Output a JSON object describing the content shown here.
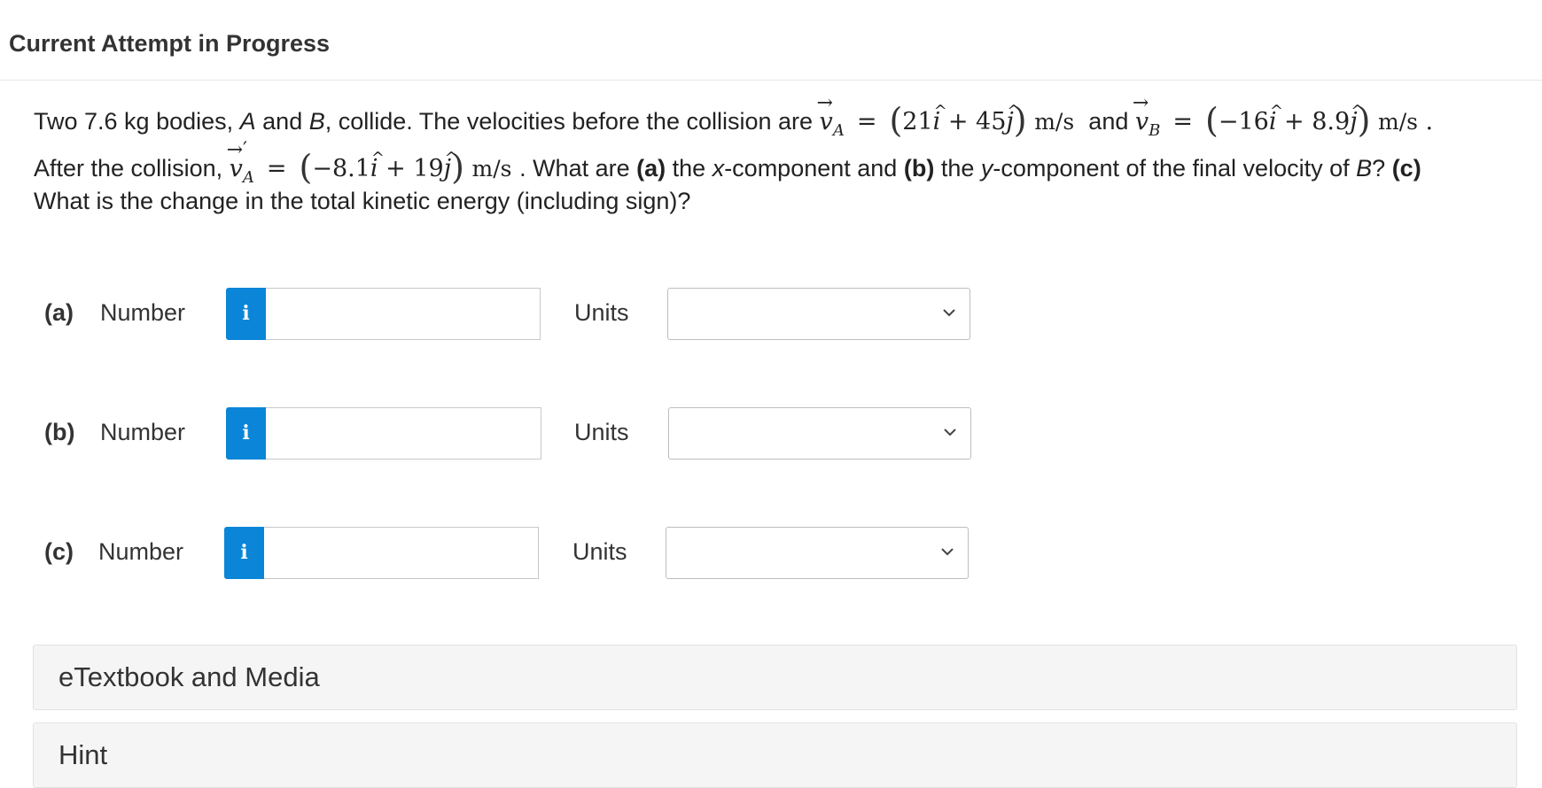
{
  "header": {
    "title": "Current Attempt in Progress"
  },
  "question": {
    "line1_text": "Two 7.6 kg bodies, A and B, collide. The velocities before the collision are",
    "vA_before": "(21î + 45ĵ) m/s",
    "and": "and",
    "vB_before": "(−16î + 8.9ĵ) m/s",
    "after_text": "After the collision,",
    "vA_after": "(−8.1î + 19ĵ) m/s",
    "what_are": ". What are",
    "part_a": "(a)",
    "a_text": "the x-component and",
    "part_b": "(b)",
    "b_text": "the y-component of the final velocity of B?",
    "part_c": "(c)",
    "c_text": "What is the change in the total kinetic energy (including sign)?"
  },
  "answers": [
    {
      "part": "(a)",
      "number_label": "Number",
      "info_icon": "i",
      "value": "",
      "units_label": "Units",
      "units_value": ""
    },
    {
      "part": "(b)",
      "number_label": "Number",
      "info_icon": "i",
      "value": "",
      "units_label": "Units",
      "units_value": ""
    },
    {
      "part": "(c)",
      "number_label": "Number",
      "info_icon": "i",
      "value": "",
      "units_label": "Units",
      "units_value": ""
    }
  ],
  "panels": {
    "etextbook": "eTextbook and Media",
    "hint": "Hint"
  },
  "colors": {
    "info_button": "#0a85d8",
    "panel_bg": "#f5f5f5"
  }
}
